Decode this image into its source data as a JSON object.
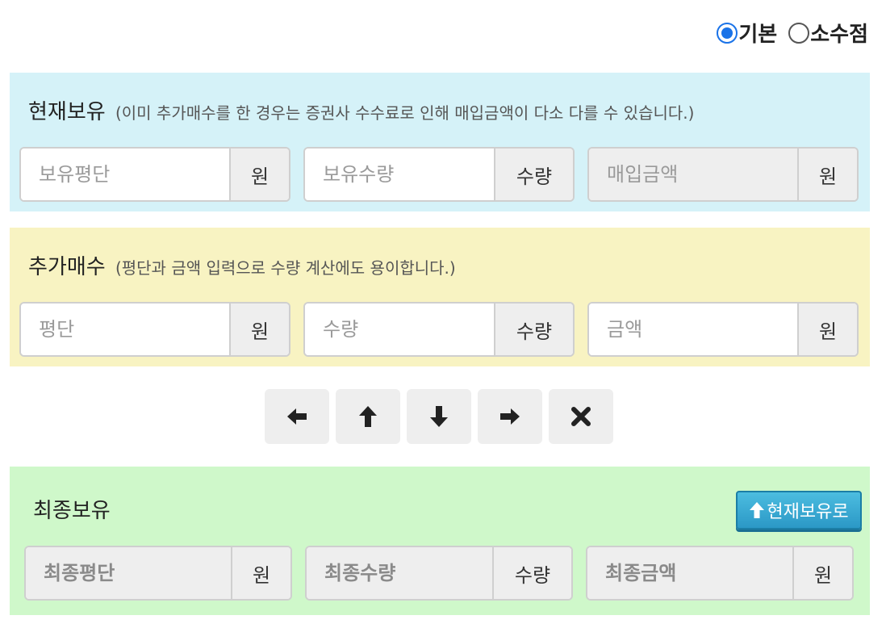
{
  "mode": {
    "options": [
      {
        "label": "기본",
        "checked": true
      },
      {
        "label": "소수점",
        "checked": false
      }
    ]
  },
  "current": {
    "title": "현재보유",
    "note": "(이미 추가매수를 한 경우는 증권사 수수료로 인해 매입금액이 다소 다를 수 있습니다.)",
    "avg_price": {
      "placeholder": "보유평단",
      "unit": "원",
      "value": ""
    },
    "quantity": {
      "placeholder": "보유수량",
      "unit": "수량",
      "value": ""
    },
    "amount": {
      "placeholder": "매입금액",
      "unit": "원",
      "value": ""
    }
  },
  "additional": {
    "title": "추가매수",
    "note": "(평단과 금액 입력으로 수량 계산에도 용이합니다.)",
    "price": {
      "placeholder": "평단",
      "unit": "원",
      "value": ""
    },
    "quantity": {
      "placeholder": "수량",
      "unit": "수량",
      "value": ""
    },
    "amount": {
      "placeholder": "금액",
      "unit": "원",
      "value": ""
    }
  },
  "actions": {
    "icons": [
      "arrow-left-icon",
      "arrow-up-icon",
      "arrow-down-icon",
      "arrow-right-icon",
      "close-icon"
    ]
  },
  "final": {
    "title": "최종보유",
    "to_current_label": "현재보유로",
    "avg_price": {
      "placeholder": "최종평단",
      "unit": "원",
      "value": ""
    },
    "quantity": {
      "placeholder": "최종수량",
      "unit": "수량",
      "value": ""
    },
    "amount": {
      "placeholder": "최종금액",
      "unit": "원",
      "value": ""
    }
  },
  "colors": {
    "current_bg": "#d5f2f8",
    "additional_bg": "#f8f3c2",
    "final_bg": "#cff8ca",
    "radio_accent": "#1a73e8",
    "button_blue": "#2b98c6"
  }
}
